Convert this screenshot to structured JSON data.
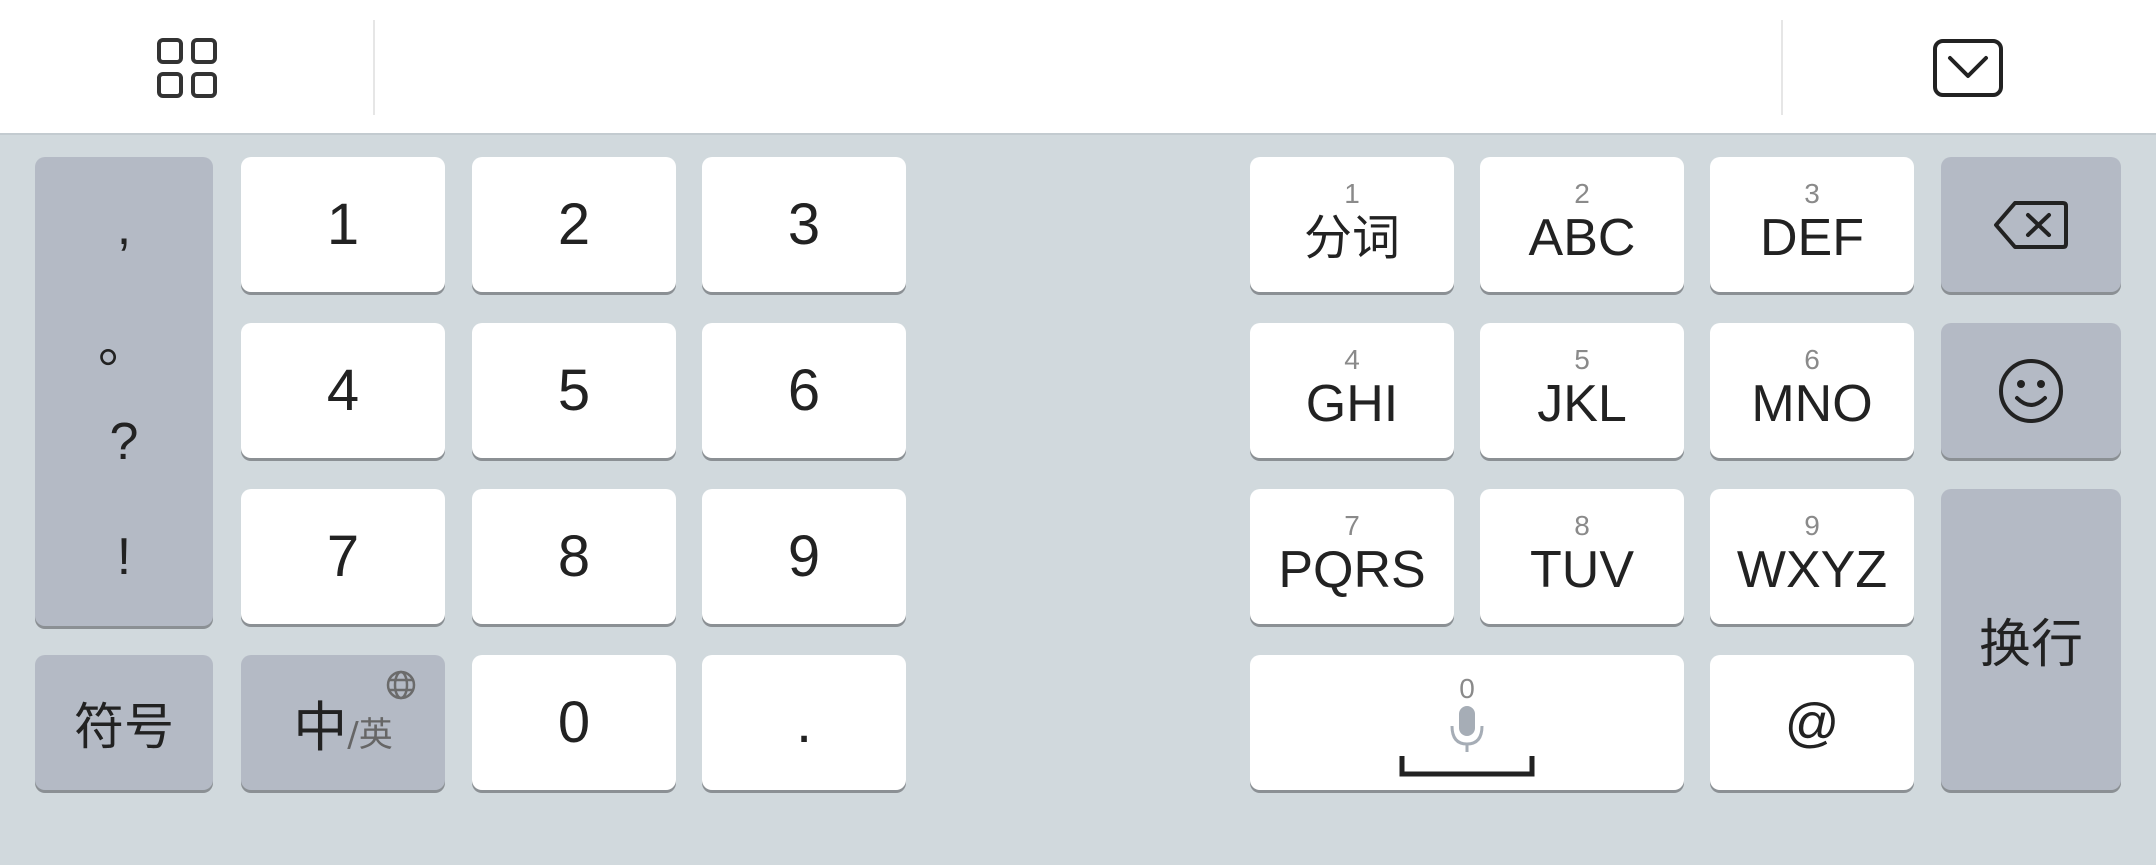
{
  "toolbar": {
    "menu_icon": "grid-icon",
    "hide_icon": "keyboard-hide-icon"
  },
  "punctuation": [
    ",",
    "。",
    "?",
    "!"
  ],
  "symbol_key": "符号",
  "lang_key": {
    "main": "中",
    "sub": "/英",
    "icon": "globe-icon"
  },
  "numpad": [
    "1",
    "2",
    "3",
    "4",
    "5",
    "6",
    "7",
    "8",
    "9",
    "0",
    "."
  ],
  "t9": [
    {
      "num": "1",
      "letters": "分词"
    },
    {
      "num": "2",
      "letters": "ABC"
    },
    {
      "num": "3",
      "letters": "DEF"
    },
    {
      "num": "4",
      "letters": "GHI"
    },
    {
      "num": "5",
      "letters": "JKL"
    },
    {
      "num": "6",
      "letters": "MNO"
    },
    {
      "num": "7",
      "letters": "PQRS"
    },
    {
      "num": "8",
      "letters": "TUV"
    },
    {
      "num": "9",
      "letters": "WXYZ"
    }
  ],
  "space_key": {
    "num": "0",
    "icons": [
      "microphone-icon",
      "space-icon"
    ]
  },
  "at_key": "@",
  "enter_key": "换行",
  "side_icons": [
    "backspace-icon",
    "emoji-icon"
  ]
}
